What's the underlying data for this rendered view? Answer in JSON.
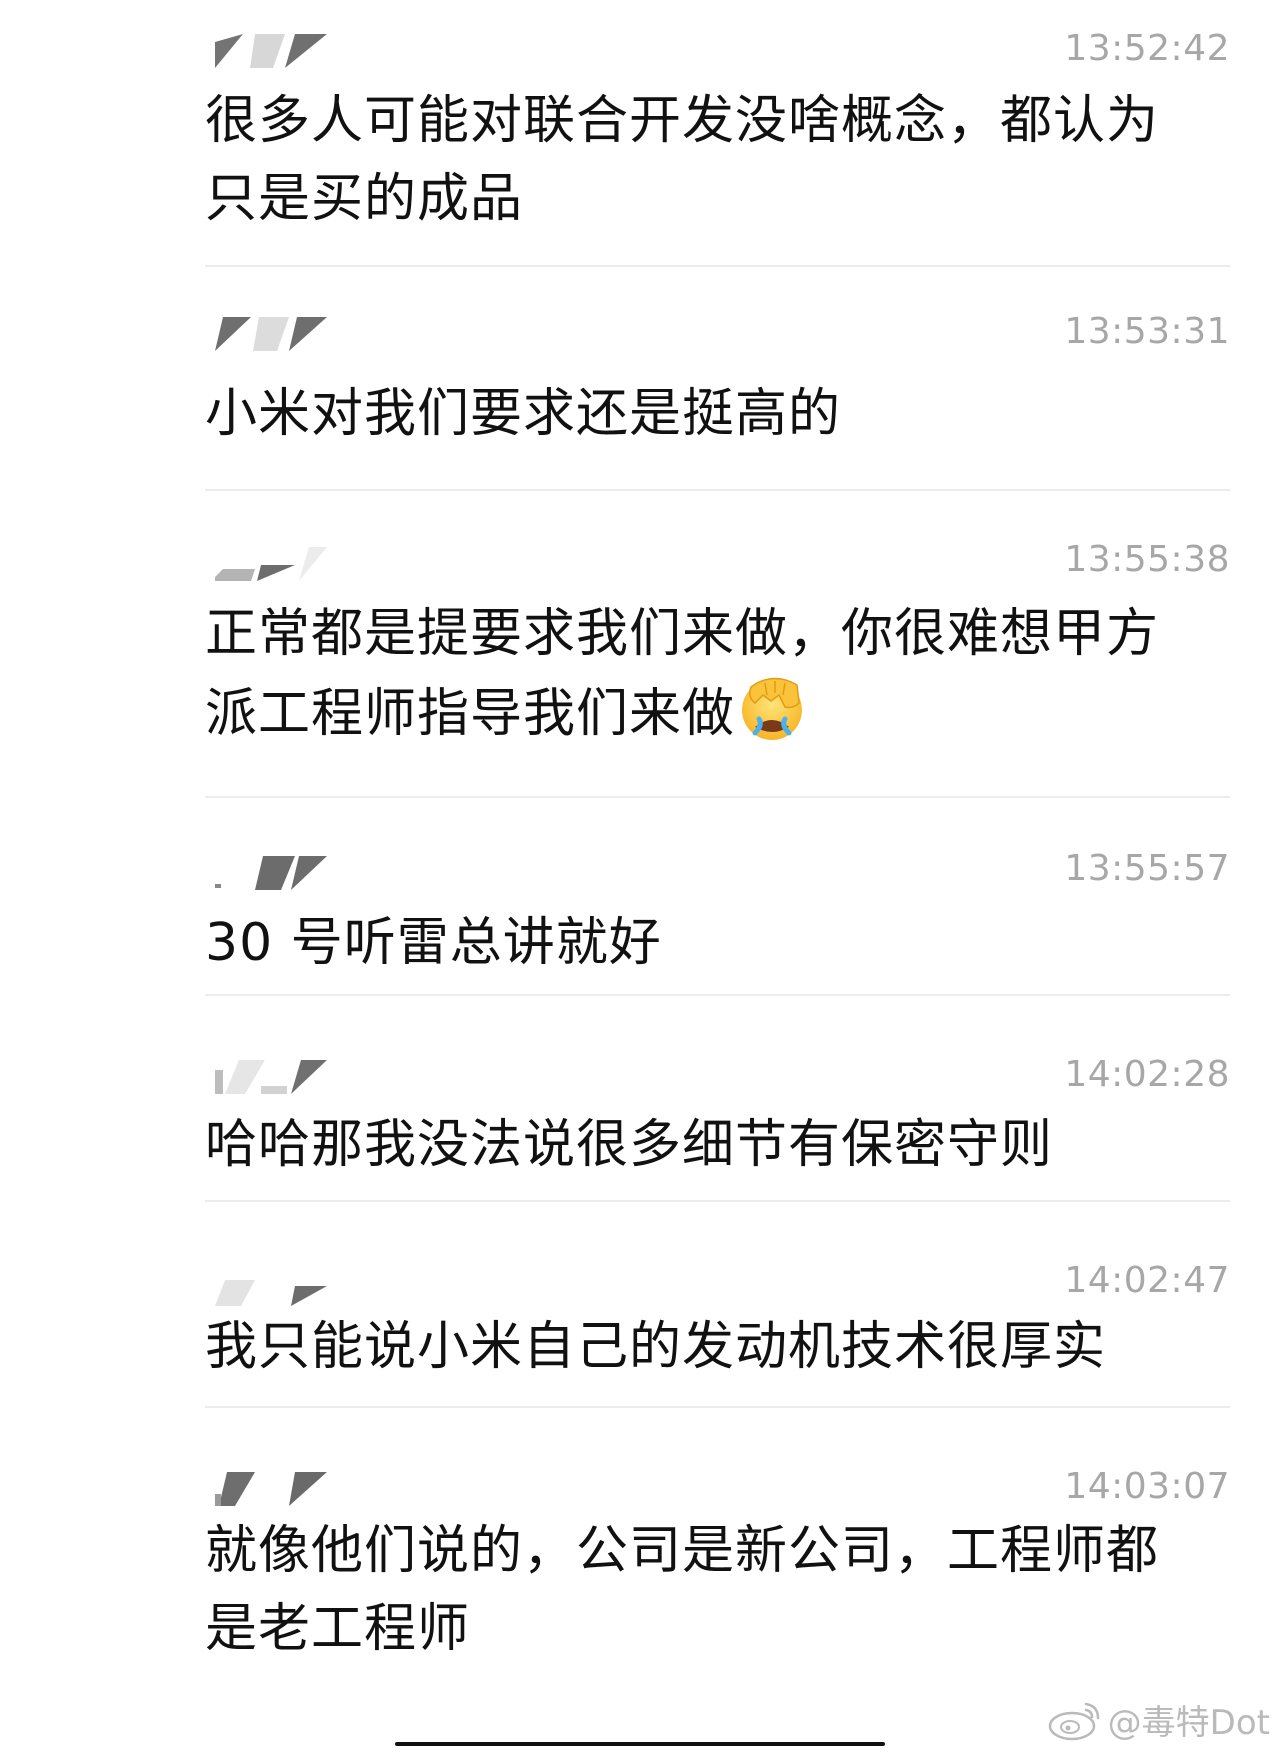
{
  "messages": [
    {
      "time": "13:52:42",
      "text": "很多人可能对联合开发没啥概念，都认为只是买的成品"
    },
    {
      "time": "13:53:31",
      "text": "小米对我们要求还是挺高的"
    },
    {
      "time": "13:55:38",
      "text": "正常都是提要求我们来做，你很难想甲方派工程师指导我们来做"
    },
    {
      "time": "13:55:57",
      "text": "30 号听雷总讲就好"
    },
    {
      "time": "14:02:28",
      "text": "哈哈那我没法说很多细节有保密守则"
    },
    {
      "time": "14:02:47",
      "text": "我只能说小米自己的发动机技术很厚实"
    },
    {
      "time": "14:03:07",
      "text": "就像他们说的，公司是新公司，工程师都是老工程师"
    }
  ],
  "emoji": {
    "name": "face-palm-crying-emoji"
  },
  "watermark": {
    "text": "@毒特Dot",
    "icon": "weibo-icon"
  },
  "colors": {
    "text": "#111111",
    "timestamp": "#a7a7a7",
    "divider": "#ececec",
    "redaction": "#6f6f6f"
  }
}
